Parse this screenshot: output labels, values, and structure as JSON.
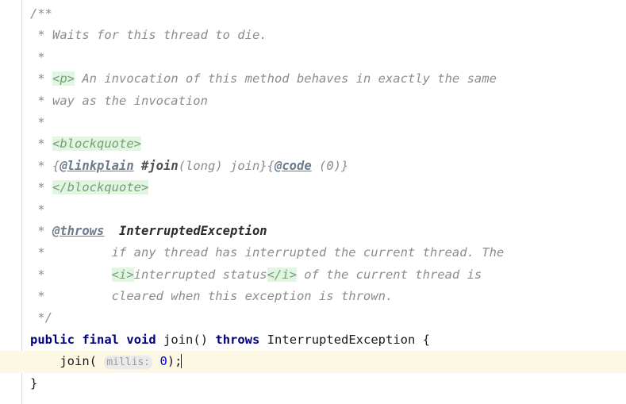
{
  "editor": {
    "language": "java",
    "background_color": "#ffffff",
    "current_line_highlight_color": "#fdf8e3",
    "gutter_rule_color": "#d8d8d8",
    "keyword_color": "#000080",
    "comment_color": "#8c8c8c",
    "html_tag_highlight_color": "#e1f6e1",
    "html_tag_text_color": "#7a9b7a",
    "inlay_hint_background": "#eaeaea",
    "inlay_hint_text_color": "#9a9a9a",
    "number_literal_color": "#0000d0",
    "caret_line_index": 16
  },
  "code": {
    "line01": {
      "open": "/**"
    },
    "line02": {
      "star": " * ",
      "text": "Waits for this thread to die."
    },
    "line03": {
      "star": " *"
    },
    "line04": {
      "star": " * ",
      "tag": "<p>",
      "text": " An invocation of this method behaves in exactly the same"
    },
    "line05": {
      "star": " * ",
      "text": "way as the invocation"
    },
    "line06": {
      "star": " *"
    },
    "line07": {
      "star": " * ",
      "tag": "<blockquote>"
    },
    "line08": {
      "star": " * ",
      "brace_open": "{",
      "jdtag1": "@linkplain",
      "space1": " ",
      "bold": "#join",
      "mid": "(long) join}{",
      "jdtag2": "@code",
      "tail": " (0)}"
    },
    "line09": {
      "star": " * ",
      "tag": "</blockquote>"
    },
    "line10": {
      "star": " *"
    },
    "line11": {
      "star": " * ",
      "jdtag": "@throws",
      "gap": "  ",
      "exception": "InterruptedException"
    },
    "line12": {
      "star": " * ",
      "indent": "        ",
      "text": "if any thread has interrupted the current thread. The"
    },
    "line13": {
      "star": " * ",
      "indent": "        ",
      "tag_open": "<i>",
      "text": "interrupted status",
      "tag_close": "</i>",
      "tail": " of the current thread is"
    },
    "line14": {
      "star": " * ",
      "indent": "        ",
      "text": "cleared when this exception is thrown."
    },
    "line15": {
      "close": " */"
    },
    "line16": {
      "kw_public": "public",
      "sp1": " ",
      "kw_final": "final",
      "sp2": " ",
      "kw_void": "void",
      "sp3": " ",
      "signature": "join() ",
      "kw_throws": "throws",
      "sp4": " ",
      "exception_type": "InterruptedException {"
    },
    "line17": {
      "indent": "    ",
      "call_open": "join( ",
      "hint": "millis:",
      "sp": " ",
      "number": "0",
      "call_close": ");"
    },
    "line18": {
      "brace": "}"
    }
  }
}
